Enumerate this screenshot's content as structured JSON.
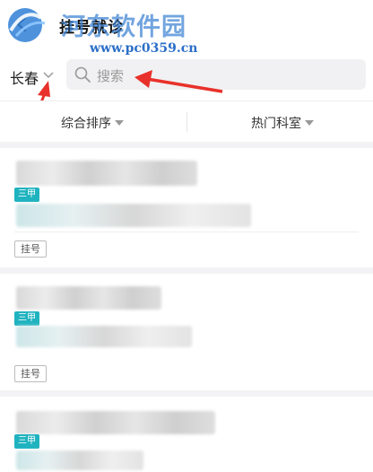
{
  "header": {
    "title": "挂号就诊",
    "watermark_text": "河东软件园",
    "watermark_url": "www.pc0359.cn"
  },
  "search": {
    "city": "长春",
    "placeholder": "搜索"
  },
  "filters": {
    "sort_label": "综合排序",
    "dept_label": "热门科室"
  },
  "hospitals": [
    {
      "grade_badge": "三甲",
      "register_label": "挂号"
    },
    {
      "grade_badge": "三甲",
      "register_label": "挂号"
    },
    {
      "grade_badge": "三甲"
    }
  ],
  "colors": {
    "badge": "#1fb3bf",
    "arrow": "#e8312a",
    "watermark": "#2b6fc8"
  },
  "icons": {
    "back": "back-arrow-icon",
    "chevron": "chevron-down-icon",
    "search": "search-icon",
    "sort": "triangle-down-icon"
  }
}
